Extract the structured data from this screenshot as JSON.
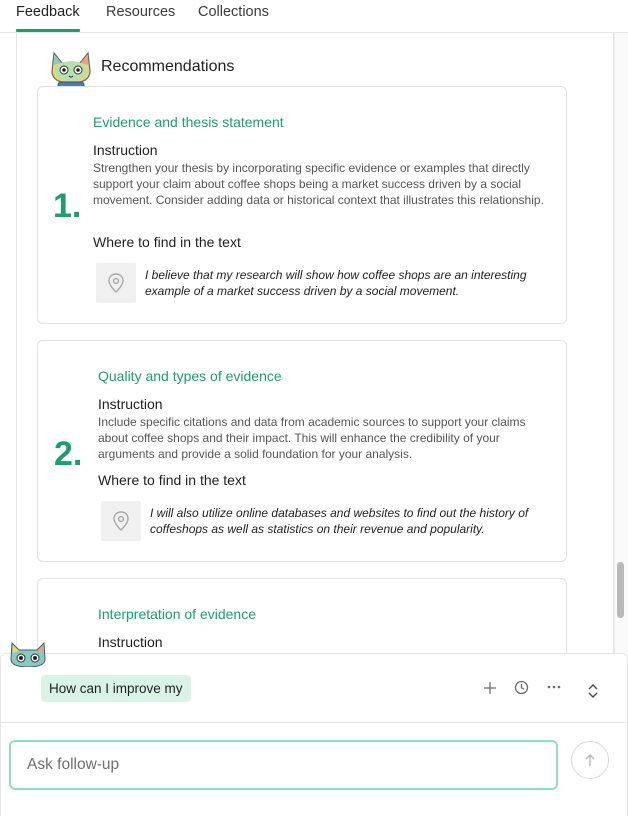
{
  "tabs": [
    {
      "label": "Feedback",
      "active": true
    },
    {
      "label": "Resources",
      "active": false
    },
    {
      "label": "Collections",
      "active": false
    }
  ],
  "recommendations": {
    "header": "Recommendations",
    "items": [
      {
        "number": "1.",
        "title": "Evidence and thesis statement",
        "instruction_label": "Instruction",
        "instruction": "Strengthen your thesis by incorporating specific evidence or examples that directly support your claim about coffee shops being a market success driven by a social movement. Consider adding data or historical context that illustrates this relationship.",
        "where_label": "Where to find in the text",
        "quote": "I believe that my research will show how coffee shops are an interesting example of a market success driven by a social movement."
      },
      {
        "number": "2.",
        "title": "Quality and types of evidence",
        "instruction_label": "Instruction",
        "instruction": "Include specific citations and data from academic sources to support your claims about coffee shops and their impact. This will enhance the credibility of your arguments and provide a solid foundation for your analysis.",
        "where_label": "Where to find in the text",
        "quote": "I will also utilize online databases and websites to find out the history of coffeshops as well as statistics on their revenue and popularity."
      },
      {
        "title": "Interpretation of evidence",
        "instruction_label": "Instruction"
      }
    ]
  },
  "chat": {
    "suggestion": "How can I improve my",
    "input_placeholder": "Ask follow-up"
  },
  "colors": {
    "accent": "#1e9d6d",
    "chip_bg": "#d9f4e7",
    "input_border": "#8fe0bf"
  }
}
